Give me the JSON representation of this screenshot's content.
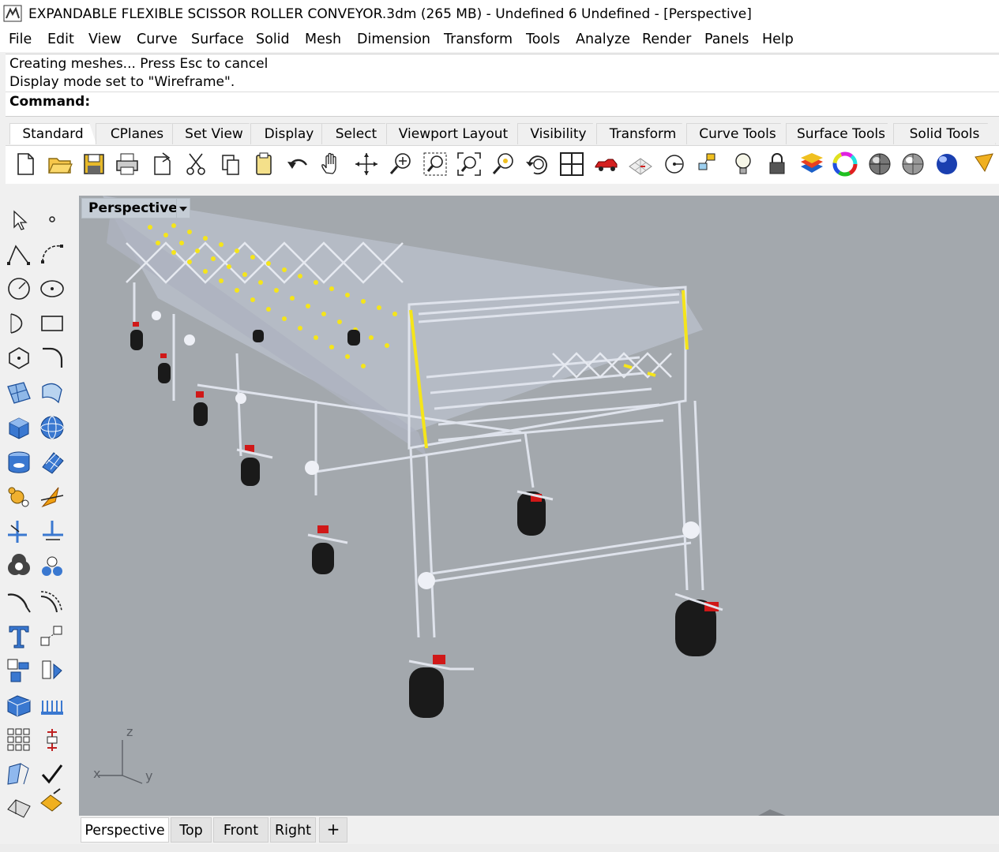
{
  "window": {
    "title": "EXPANDABLE FLEXIBLE SCISSOR ROLLER CONVEYOR.3dm (265 MB) - Undefined 6 Undefined - [Perspective]"
  },
  "menu": [
    "File",
    "Edit",
    "View",
    "Curve",
    "Surface",
    "Solid",
    "Mesh",
    "Dimension",
    "Transform",
    "Tools",
    "Analyze",
    "Render",
    "Panels",
    "Help"
  ],
  "command": {
    "history": [
      "Creating meshes... Press Esc to cancel",
      "Display mode set to \"Wireframe\"."
    ],
    "prompt": "Command:"
  },
  "toolbar_tabs": [
    "Standard",
    "CPlanes",
    "Set View",
    "Display",
    "Select",
    "Viewport Layout",
    "Visibility",
    "Transform",
    "Curve Tools",
    "Surface Tools",
    "Solid Tools"
  ],
  "active_toolbar_tab": "Standard",
  "toolbar_icons": [
    "new-document-icon",
    "open-folder-icon",
    "save-icon",
    "print-icon",
    "import-icon",
    "cut-icon",
    "copy-icon",
    "paste-icon",
    "undo-icon",
    "pan-hand-icon",
    "rotate-view-icon",
    "zoom-dynamic-icon",
    "zoom-window-icon",
    "zoom-extents-icon",
    "zoom-selected-icon",
    "rotate-camera-icon",
    "four-viewports-icon",
    "car-icon",
    "grid-options-icon",
    "cplane-icon",
    "object-snap-icon",
    "light-bulb-icon",
    "lock-icon",
    "layer-icon",
    "color-wheel-icon",
    "shaded-sphere-icon",
    "rendered-sphere-icon",
    "render-sphere-icon",
    "render-cone-icon"
  ],
  "sidebar_icons": [
    "select-arrow-icon",
    "point-icon",
    "polyline-icon",
    "curve-icon",
    "circle-icon",
    "ellipse-icon",
    "arc-icon",
    "rectangle-icon",
    "polygon-icon",
    "fillet-icon",
    "surface-corner-icon",
    "surface-edge-icon",
    "box-icon",
    "sphere-icon",
    "cylinder-icon",
    "mesh-plane-icon",
    "explode-icon",
    "trim-icon",
    "split-icon",
    "join-icon",
    "boolean-union-icon",
    "boolean-split-icon",
    "offset-curve-icon",
    "array-curve-icon",
    "text-icon",
    "scale-icon",
    "group-icon",
    "mirror-icon",
    "extrude-icon",
    "point-cloud-icon",
    "grid-array-icon",
    "dimension-icon",
    "cplane-3pt-icon",
    "check-icon",
    "analyze-icon",
    "paint-bucket-icon"
  ],
  "viewport": {
    "label": "Perspective",
    "axis_labels": {
      "x": "x",
      "y": "y",
      "z": "z"
    },
    "colors": {
      "background": "#a3a8ad",
      "frame": "#d4d7e0",
      "roller_highlight": "#f5e51a",
      "caster": "#1a1a1a",
      "brake": "#d01818"
    }
  },
  "viewport_tabs": [
    "Perspective",
    "Top",
    "Front",
    "Right"
  ],
  "active_viewport_tab": "Perspective",
  "add_viewport_symbol": "+"
}
